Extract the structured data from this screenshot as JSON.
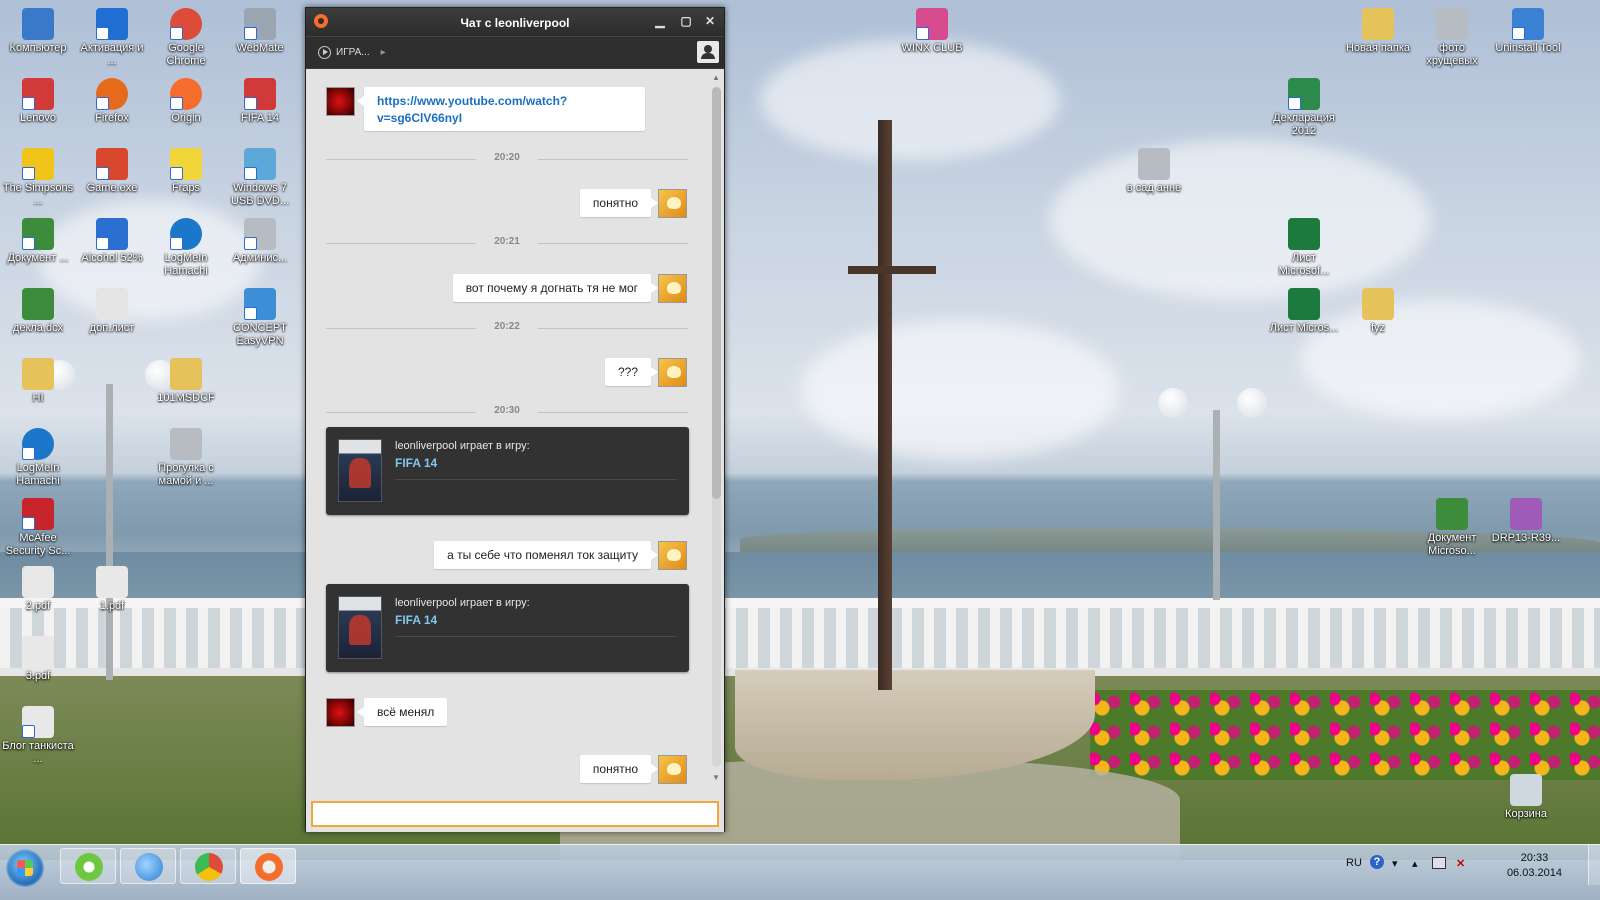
{
  "desktop": {
    "icons": [
      {
        "label": "Компьютер",
        "color": "#3a78c9"
      },
      {
        "label": "Активация и ...",
        "color": "#1e6fd1"
      },
      {
        "label": "Google Chrome",
        "color": "#dd4b39"
      },
      {
        "label": "WebMate",
        "color": "#9aa6b2"
      },
      {
        "label": "Uninstall Tool",
        "color": "#3b82d6"
      },
      {
        "label": "Новая папка",
        "color": "#e6c25a"
      },
      {
        "label": "фото хрущевых",
        "color": "#b7bcc2"
      },
      {
        "label": "WINX CLUB",
        "color": "#d64b8e"
      },
      {
        "label": "FIFA 14",
        "color": "#d23a3a"
      },
      {
        "label": "Декларация 2012",
        "color": "#2c8a4a"
      },
      {
        "label": "в сад анне",
        "color": "#b7bcc2"
      },
      {
        "label": "The Simpsons ...",
        "color": "#f0c419"
      },
      {
        "label": "Game.exe",
        "color": "#d8462d"
      },
      {
        "label": "Fraps",
        "color": "#f2d43b"
      },
      {
        "label": "Windows 7 USB DVD...",
        "color": "#5ba8d9"
      },
      {
        "label": "Документ ...",
        "color": "#3c8c3c"
      },
      {
        "label": "Alcohol 52%",
        "color": "#2b6fd1"
      },
      {
        "label": "LogMeIn Hamachi",
        "color": "#1a77c9"
      },
      {
        "label": "Админис...",
        "color": "#b7bcc2"
      },
      {
        "label": "Лист Microsof...",
        "color": "#1d7a3e"
      },
      {
        "label": "декла.dcx",
        "color": "#3c8c3c"
      },
      {
        "label": "доп.лист",
        "color": "#e5e5e5"
      },
      {
        "label": "CONCEPT EasyVPN",
        "color": "#3c8fd6"
      },
      {
        "label": "Лист Micros...",
        "color": "#1d7a3e"
      },
      {
        "label": "fyz",
        "color": "#e6c25a"
      },
      {
        "label": "HI",
        "color": "#e6c25a"
      },
      {
        "label": "101MSDCF",
        "color": "#e6c25a"
      },
      {
        "label": "LogMeIn Hamachi",
        "color": "#1a77c9"
      },
      {
        "label": "Прогулка с мамой и ...",
        "color": "#b7bcc2"
      },
      {
        "label": "McAfee Security Sc...",
        "color": "#c8242b"
      },
      {
        "label": "Документ Microso...",
        "color": "#3c8c3c"
      },
      {
        "label": "DRP13-R39...",
        "color": "#a05ab8"
      },
      {
        "label": "2.pdf",
        "color": "#e8e8e8"
      },
      {
        "label": "1.pdf",
        "color": "#e8e8e8"
      },
      {
        "label": "3.pdf",
        "color": "#e8e8e8"
      },
      {
        "label": "Блог танкиста ...",
        "color": "#e8e8e8"
      },
      {
        "label": "Корзина",
        "color": "#cfd8df"
      },
      {
        "label": "Origin",
        "color": "#f56c2d"
      },
      {
        "label": "Firefox",
        "color": "#e66a1c"
      },
      {
        "label": "Lenovo",
        "color": "#d23a3a"
      }
    ]
  },
  "chat": {
    "title": "Чат с leonliverpool",
    "min_label": "▁",
    "max_label": "▢",
    "close_label": "✕",
    "game_menu_label": "ИГРА...",
    "game_menu_arrow": "▸",
    "scroll_up": "▲",
    "scroll_down": "▼",
    "input_value": "",
    "messages": {
      "link_line1": "https://www.youtube.com/watch?",
      "link_line2": "v=sg6ClV66nyI",
      "t1": "20:20",
      "m1": "понятно",
      "t2": "20:21",
      "m2": "вот почему я догнать тя не мог",
      "t3": "20:22",
      "m3": "???",
      "t4": "20:30",
      "card1_text": "leonliverpool играет в игру:",
      "card1_game": "FIFA 14",
      "m4": "а ты себе что поменял ток защиту",
      "card2_text": "leonliverpool играет в игру:",
      "card2_game": "FIFA 14",
      "m5": "всё менял",
      "m6": "понятно"
    }
  },
  "taskbar": {
    "lang": "RU",
    "help": "?",
    "time": "20:33",
    "date": "06.03.2014",
    "apps": [
      {
        "name": "ICQ",
        "color": "#6ec641"
      },
      {
        "name": "Internet Explorer",
        "color": "#2f7fd1"
      },
      {
        "name": "Google Chrome",
        "color": "#dd4b39"
      },
      {
        "name": "Origin",
        "color": "#f56c2d"
      }
    ]
  }
}
